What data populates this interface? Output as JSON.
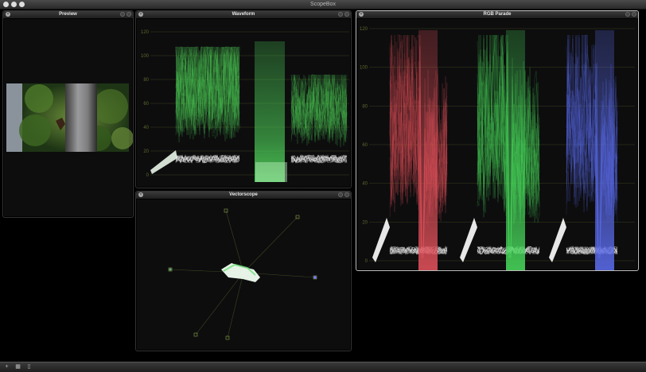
{
  "window": {
    "title": "ScopeBox"
  },
  "panels": {
    "preview": {
      "title": "Preview"
    },
    "waveform": {
      "title": "Waveform",
      "grid_labels": [
        "120",
        "100",
        "80",
        "60",
        "40",
        "20",
        "0"
      ]
    },
    "vectorscope": {
      "title": "Vectorscope"
    },
    "parade": {
      "title": "RGB Parade",
      "grid_labels": [
        "120",
        "100",
        "80",
        "60",
        "40",
        "20",
        "0"
      ]
    }
  },
  "colors": {
    "waveform": "#4fd35a",
    "red": "#e0505a",
    "green": "#47d65a",
    "blue": "#5a6ae8",
    "graticule": "#5a6b2a"
  },
  "icons": {
    "close": "close-icon",
    "zoom": "zoom-icon",
    "options": "options-icon"
  },
  "bottombar": {
    "buttons": [
      {
        "name": "add-scope-button",
        "glyph": "+"
      },
      {
        "name": "grid-layout-button",
        "glyph": "▦"
      },
      {
        "name": "document-button",
        "glyph": "▯"
      }
    ]
  }
}
